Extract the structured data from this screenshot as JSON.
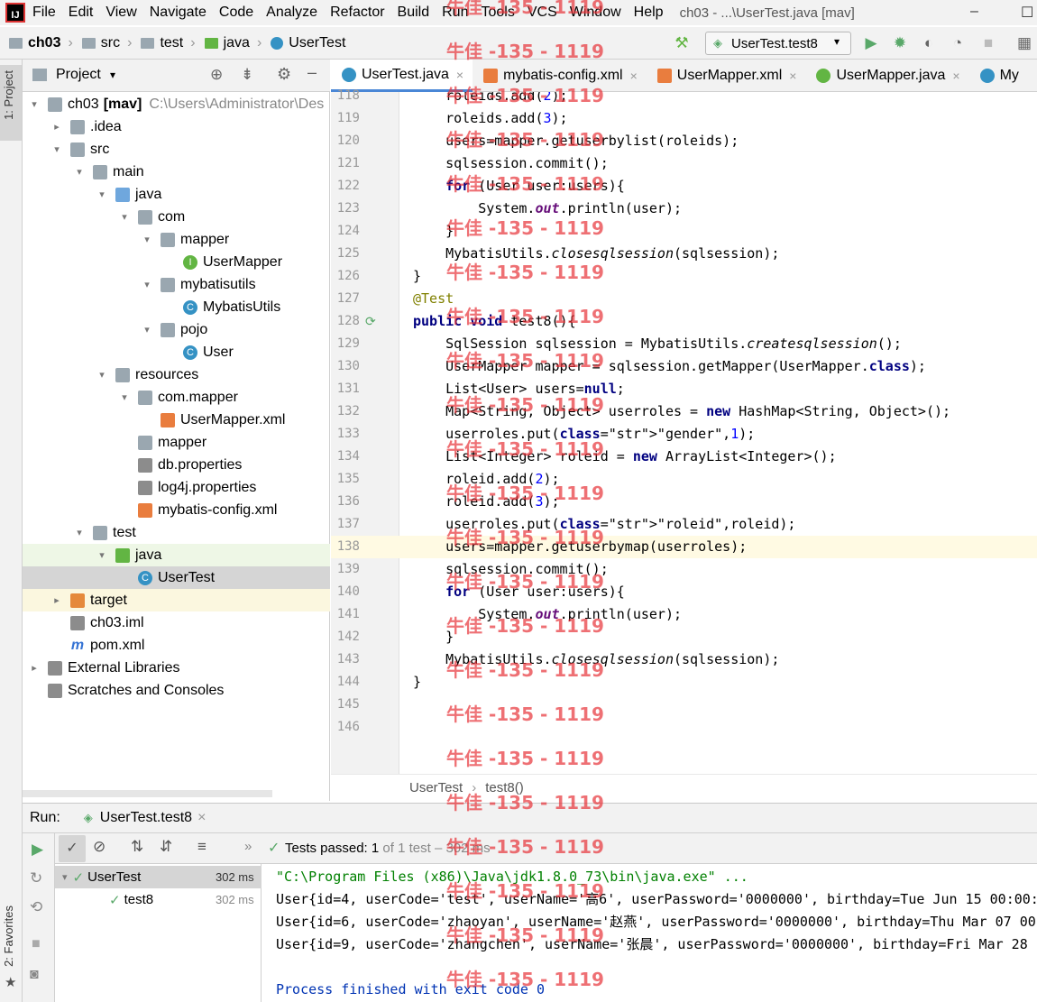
{
  "menubar": {
    "logo": "IJ",
    "items": [
      "File",
      "Edit",
      "View",
      "Navigate",
      "Code",
      "Analyze",
      "Refactor",
      "Build",
      "Run",
      "Tools",
      "VCS",
      "Window",
      "Help"
    ],
    "window_title": "ch03 - ...\\UserTest.java [mav]",
    "minimize": "–",
    "maximize": "☐"
  },
  "breadcrumbs": [
    "ch03",
    "src",
    "test",
    "java",
    "UserTest"
  ],
  "run_config": "UserTest.test8",
  "project_panel": {
    "title": "Project",
    "vertical_tab": "1: Project",
    "favorites_tab": "2: Favorites",
    "tree": [
      {
        "label": "ch03",
        "extra": "[mav]",
        "path": "C:\\Users\\Administrator\\Des",
        "depth": 0,
        "arrow": "▾",
        "icon": "folder"
      },
      {
        "label": ".idea",
        "depth": 1,
        "arrow": "▸",
        "icon": "folder"
      },
      {
        "label": "src",
        "depth": 1,
        "arrow": "▾",
        "icon": "folder"
      },
      {
        "label": "main",
        "depth": 2,
        "arrow": "▾",
        "icon": "folder"
      },
      {
        "label": "java",
        "depth": 3,
        "arrow": "▾",
        "icon": "folder-blue"
      },
      {
        "label": "com",
        "depth": 4,
        "arrow": "▾",
        "icon": "folder"
      },
      {
        "label": "mapper",
        "depth": 5,
        "arrow": "▾",
        "icon": "folder"
      },
      {
        "label": "UserMapper",
        "depth": 6,
        "arrow": "",
        "icon": "ifc"
      },
      {
        "label": "mybatisutils",
        "depth": 5,
        "arrow": "▾",
        "icon": "folder"
      },
      {
        "label": "MybatisUtils",
        "depth": 6,
        "arrow": "",
        "icon": "cls"
      },
      {
        "label": "pojo",
        "depth": 5,
        "arrow": "▾",
        "icon": "folder"
      },
      {
        "label": "User",
        "depth": 6,
        "arrow": "",
        "icon": "cls"
      },
      {
        "label": "resources",
        "depth": 3,
        "arrow": "▾",
        "icon": "folder"
      },
      {
        "label": "com.mapper",
        "depth": 4,
        "arrow": "▾",
        "icon": "folder"
      },
      {
        "label": "UserMapper.xml",
        "depth": 5,
        "arrow": "",
        "icon": "xml"
      },
      {
        "label": "mapper",
        "depth": 4,
        "arrow": "",
        "icon": "folder"
      },
      {
        "label": "db.properties",
        "depth": 4,
        "arrow": "",
        "icon": "props"
      },
      {
        "label": "log4j.properties",
        "depth": 4,
        "arrow": "",
        "icon": "props"
      },
      {
        "label": "mybatis-config.xml",
        "depth": 4,
        "arrow": "",
        "icon": "xml"
      },
      {
        "label": "test",
        "depth": 2,
        "arrow": "▾",
        "icon": "folder"
      },
      {
        "label": "java",
        "depth": 3,
        "arrow": "▾",
        "icon": "folder-green"
      },
      {
        "label": "UserTest",
        "depth": 4,
        "arrow": "",
        "icon": "cls"
      },
      {
        "label": "target",
        "depth": 1,
        "arrow": "▸",
        "icon": "folder-orange"
      },
      {
        "label": "ch03.iml",
        "depth": 1,
        "arrow": "",
        "icon": "props"
      },
      {
        "label": "pom.xml",
        "depth": 1,
        "arrow": "",
        "icon": "mvn"
      },
      {
        "label": "External Libraries",
        "depth": 0,
        "arrow": "▸",
        "icon": "props"
      },
      {
        "label": "Scratches and Consoles",
        "depth": 0,
        "arrow": "",
        "icon": "props"
      }
    ]
  },
  "editor_tabs": [
    {
      "label": "UserTest.java",
      "active": true
    },
    {
      "label": "mybatis-config.xml",
      "active": false
    },
    {
      "label": "UserMapper.xml",
      "active": false
    },
    {
      "label": "UserMapper.java",
      "active": false
    },
    {
      "label": "My",
      "active": false
    }
  ],
  "code_lines": [
    {
      "n": "118",
      "t": "    roleids.add(2);"
    },
    {
      "n": "119",
      "t": "    roleids.add(3);"
    },
    {
      "n": "120",
      "t": "    users=mapper.getuserbylist(roleids);"
    },
    {
      "n": "121",
      "t": "    sqlsession.commit();"
    },
    {
      "n": "122",
      "t": "    for (User user:users){"
    },
    {
      "n": "123",
      "t": "        System.out.println(user);"
    },
    {
      "n": "124",
      "t": "    }"
    },
    {
      "n": "125",
      "t": "    MybatisUtils.closesqlsession(sqlsession);"
    },
    {
      "n": "126",
      "t": "}"
    },
    {
      "n": "127",
      "t": "@Test"
    },
    {
      "n": "128",
      "t": "public void test8(){"
    },
    {
      "n": "129",
      "t": "    SqlSession sqlsession = MybatisUtils.createsqlsession();"
    },
    {
      "n": "130",
      "t": "    UserMapper mapper = sqlsession.getMapper(UserMapper.class);"
    },
    {
      "n": "131",
      "t": "    List<User> users=null;"
    },
    {
      "n": "132",
      "t": "    Map<String, Object> userroles = new HashMap<String, Object>();"
    },
    {
      "n": "133",
      "t": "    userroles.put(\"gender\",1);"
    },
    {
      "n": "134",
      "t": "    List<Integer> roleid = new ArrayList<Integer>();"
    },
    {
      "n": "135",
      "t": "    roleid.add(2);"
    },
    {
      "n": "136",
      "t": "    roleid.add(3);"
    },
    {
      "n": "137",
      "t": "    userroles.put(\"roleid\",roleid);"
    },
    {
      "n": "138",
      "t": "    users=mapper.getuserbymap(userroles);"
    },
    {
      "n": "139",
      "t": "    sqlsession.commit();"
    },
    {
      "n": "140",
      "t": "    for (User user:users){"
    },
    {
      "n": "141",
      "t": "        System.out.println(user);"
    },
    {
      "n": "142",
      "t": "    }"
    },
    {
      "n": "143",
      "t": "    MybatisUtils.closesqlsession(sqlsession);"
    },
    {
      "n": "144",
      "t": "}"
    },
    {
      "n": "145",
      "t": ""
    },
    {
      "n": "146",
      "t": ""
    }
  ],
  "editor_breadcrumb": [
    "UserTest",
    "test8()"
  ],
  "run_panel": {
    "label": "Run:",
    "tab": "UserTest.test8",
    "status_prefix": "Tests passed:",
    "status_count": "1",
    "status_suffix": "of 1 test – 302 ms",
    "tests": [
      {
        "name": "UserTest",
        "time": "302 ms"
      },
      {
        "name": "test8",
        "time": "302 ms"
      }
    ],
    "console": [
      "\"C:\\Program Files (x86)\\Java\\jdk1.8.0_73\\bin\\java.exe\" ...",
      "User{id=4, userCode='test', userName='高6', userPassword='0000000', birthday=Tue Jun 15 00:00:",
      "User{id=6, userCode='zhaoyan', userName='赵燕', userPassword='0000000', birthday=Thu Mar 07 00",
      "User{id=9, userCode='zhangchen', userName='张晨', userPassword='0000000', birthday=Fri Mar 28 (",
      "",
      "Process finished with exit code 0"
    ]
  },
  "watermark": "牛佳 -135 - 1119",
  "colors": {
    "accent": "#4a87d6",
    "keyword": "#000080",
    "string": "#008000",
    "pass": "#59a869",
    "watermark": "#e8343a"
  }
}
